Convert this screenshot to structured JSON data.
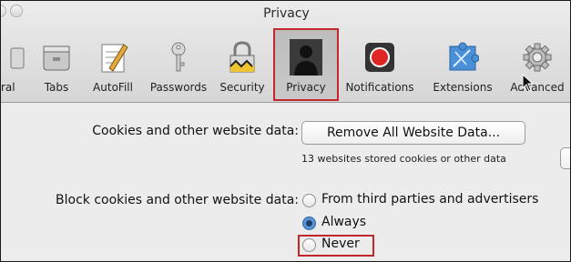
{
  "window": {
    "title": "Privacy"
  },
  "toolbar": {
    "items": [
      {
        "label": "ral",
        "icon": "general-icon"
      },
      {
        "label": "Tabs",
        "icon": "tabs-icon"
      },
      {
        "label": "AutoFill",
        "icon": "autofill-icon"
      },
      {
        "label": "Passwords",
        "icon": "key-icon"
      },
      {
        "label": "Security",
        "icon": "lock-icon"
      },
      {
        "label": "Privacy",
        "icon": "person-silhouette-icon",
        "selected": true
      },
      {
        "label": "Notifications",
        "icon": "record-icon"
      },
      {
        "label": "Extensions",
        "icon": "puzzle-icon"
      },
      {
        "label": "Advanced",
        "icon": "gear-icon"
      }
    ]
  },
  "cookies": {
    "label": "Cookies and other website data:",
    "button_label": "Remove All Website Data...",
    "note": "13 websites stored cookies or other data"
  },
  "block": {
    "label": "Block cookies and other website data:",
    "options": [
      {
        "label": "From third parties and advertisers",
        "selected": false
      },
      {
        "label": "Always",
        "selected": true
      },
      {
        "label": "Never",
        "selected": false
      }
    ]
  },
  "colors": {
    "highlight": "#c1272d",
    "accent": "#3d7cc5"
  }
}
